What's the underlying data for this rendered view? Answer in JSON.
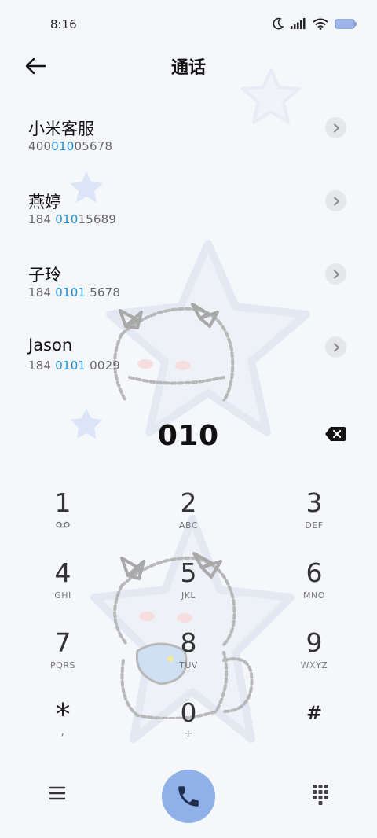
{
  "status_bar": {
    "time": "8:16"
  },
  "header": {
    "title": "通话"
  },
  "results": [
    {
      "name": "小米客服",
      "number_pre": "400",
      "number_match": "010",
      "number_post": "05678"
    },
    {
      "name": "燕婷",
      "number_pre": "184 ",
      "number_match": "010",
      "number_post": "15689"
    },
    {
      "name": "子玲",
      "number_pre": "184 ",
      "number_match": "0101",
      "number_post": " 5678"
    },
    {
      "name": "Jason",
      "number_pre": "184 ",
      "number_match": "0101",
      "number_post": " 0029"
    }
  ],
  "dialed": {
    "digits": "010"
  },
  "keypad": [
    {
      "digit": "1",
      "sub": ""
    },
    {
      "digit": "2",
      "sub": "ABC"
    },
    {
      "digit": "3",
      "sub": "DEF"
    },
    {
      "digit": "4",
      "sub": "GHI"
    },
    {
      "digit": "5",
      "sub": "JKL"
    },
    {
      "digit": "6",
      "sub": "MNO"
    },
    {
      "digit": "7",
      "sub": "PQRS"
    },
    {
      "digit": "8",
      "sub": "TUV"
    },
    {
      "digit": "9",
      "sub": "WXYZ"
    },
    {
      "digit": "*",
      "sub": ","
    },
    {
      "digit": "0",
      "sub": "+"
    },
    {
      "digit": "#",
      "sub": ""
    }
  ],
  "icons": {
    "back": "arrow-left-icon",
    "chevron": "chevron-right-icon",
    "backspace": "backspace-icon",
    "voicemail": "voicemail-icon",
    "menu": "menu-icon",
    "call": "phone-icon",
    "dialpad": "dialpad-icon"
  },
  "colors": {
    "match_highlight": "#1b8ad6",
    "call_button": "#8fb0e8"
  }
}
